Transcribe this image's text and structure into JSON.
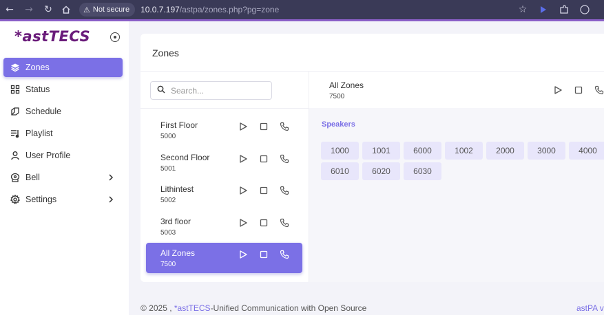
{
  "browser": {
    "security_label": "Not secure",
    "url_host": "10.0.7.197",
    "url_path": "/astpa/zones.php?pg=zone"
  },
  "sidebar": {
    "logo": "*astTECS",
    "items": [
      {
        "label": "Zones",
        "icon": "layers-icon",
        "active": true
      },
      {
        "label": "Status",
        "icon": "grid-icon"
      },
      {
        "label": "Schedule",
        "icon": "schedule-icon"
      },
      {
        "label": "Playlist",
        "icon": "playlist-icon"
      },
      {
        "label": "User Profile",
        "icon": "user-icon"
      },
      {
        "label": "Bell",
        "icon": "bell-icon",
        "has_submenu": true
      },
      {
        "label": "Settings",
        "icon": "gear-icon",
        "has_submenu": true
      }
    ]
  },
  "main": {
    "title": "Zones",
    "search_placeholder": "Search...",
    "zones": [
      {
        "name": "First Floor",
        "number": "5000"
      },
      {
        "name": "Second Floor",
        "number": "5001"
      },
      {
        "name": "Lithintest",
        "number": "5002"
      },
      {
        "name": "3rd floor",
        "number": "5003"
      },
      {
        "name": "All Zones",
        "number": "7500",
        "active": true
      }
    ],
    "selected": {
      "name": "All Zones",
      "number": "7500",
      "speakers_title": "Speakers",
      "speakers": [
        "1000",
        "1001",
        "6000",
        "1002",
        "2000",
        "3000",
        "4000",
        "6010",
        "6020",
        "6030"
      ]
    }
  },
  "footer": {
    "copyright": "© 2025 , ",
    "brand": "*astTECS",
    "tagline": "-Unified Communication with Open Source",
    "right": "astPA v"
  },
  "colors": {
    "accent": "#7b70e6",
    "logo": "#6a1b7a",
    "browser_bar": "#3a3a57"
  }
}
